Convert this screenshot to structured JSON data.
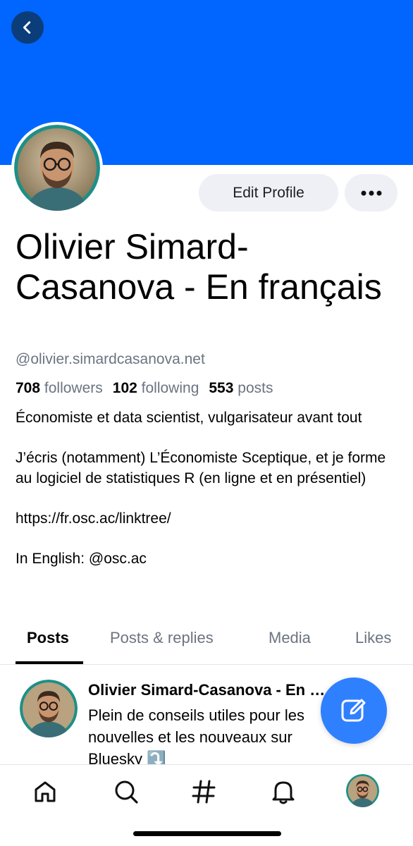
{
  "header": {
    "back_icon": "chevron-left-icon",
    "banner_color": "#0066ff"
  },
  "profile": {
    "display_name": "Olivier Simard-Casanova - En français",
    "handle": "@olivier.simardcasanova.net",
    "edit_label": "Edit Profile",
    "more_icon": "ellipsis-icon",
    "stats": {
      "followers_count": "708",
      "followers_label": "followers",
      "following_count": "102",
      "following_label": "following",
      "posts_count": "553",
      "posts_label": "posts"
    },
    "bio": {
      "line1": "Économiste et data scientist, vulgarisateur avant tout",
      "line2": "J’écris (notamment) L’Économiste Sceptique, et je forme au logiciel de statistiques R (en ligne et en présentiel)",
      "line3": "https://fr.osc.ac/linktree/",
      "line4": "In English: @osc.ac"
    }
  },
  "tabs": [
    {
      "label": "Posts",
      "active": true
    },
    {
      "label": "Posts & replies",
      "active": false
    },
    {
      "label": "Media",
      "active": false
    },
    {
      "label": "Likes",
      "active": false
    }
  ],
  "feed": {
    "post": {
      "author": "Olivier Simard-Casanova - En français",
      "text": "Plein de conseils utiles pour les nouvelles et les nouveaux sur Bluesky ⤵️"
    }
  },
  "fab": {
    "icon": "compose-icon",
    "color": "#2f80ff"
  },
  "bottom_nav": {
    "items": [
      "home-icon",
      "search-icon",
      "hashtag-icon",
      "notifications-icon",
      "profile-avatar"
    ]
  },
  "colors": {
    "accent": "#0066ff",
    "muted_text": "#6b7480",
    "avatar_ring": "#1f8f86"
  }
}
